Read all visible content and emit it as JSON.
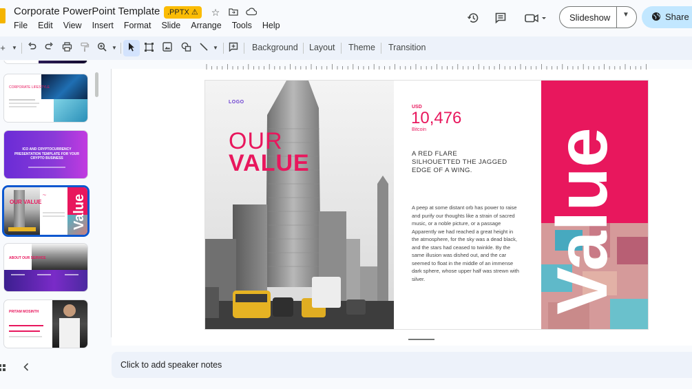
{
  "header": {
    "title": "Corporate PowerPoint Template",
    "badge": ".PPTX ⚠",
    "menu": [
      "File",
      "Edit",
      "View",
      "Insert",
      "Format",
      "Slide",
      "Arrange",
      "Tools",
      "Help"
    ],
    "slideshow_label": "Slideshow",
    "share_label": "Share"
  },
  "toolbar": {
    "items": [
      "Background",
      "Layout",
      "Theme",
      "Transition"
    ]
  },
  "filmstrip": {
    "thumbs": [
      {
        "title": "CORPORATE LIFESTYLE"
      },
      {
        "title": "ICO AND CRYPTOCURRENCY PRESENTATION TEMPLATE FOR YOUR CRYPTO BUSINESS"
      },
      {
        "title": "OUR VALUE",
        "selected": true
      },
      {
        "title": "ABOUT OUR SERVICE"
      },
      {
        "title": "PRITAM MOSINTH"
      }
    ]
  },
  "slide": {
    "logo": "LOGO",
    "title_line1": "OUR",
    "title_line2": "VALUE",
    "currency": "USD",
    "amount": "10,476",
    "coin": "Bitcoin",
    "headline": "A RED FLARE SILHOUETTED THE JAGGED EDGE OF A WING.",
    "body": "A peep at some distant orb has power to raise and purify our thoughts like a strain of sacred music, or a noble picture, or a passage Apparently we had reached a great height in the atmosphere, for the sky was a dead black, and the stars had ceased to twinkle. By the same illusion was dished out, and the car seemed to float in the middle of an immense dark sphere, whose upper half was strewn with silver.",
    "vertical_word": "Value"
  },
  "notes": {
    "placeholder": "Click to add speaker notes"
  },
  "colors": {
    "accent_pink": "#e8175d",
    "share_bg": "#c2e7ff",
    "selection_blue": "#0b57d0"
  }
}
